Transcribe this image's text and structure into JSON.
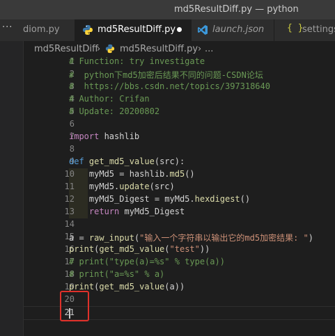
{
  "window": {
    "title": "md5ResultDiff.py — python"
  },
  "activity": {
    "overflow_glyph": "···"
  },
  "tabs": [
    {
      "label": "diom.py",
      "icon": "python-file-icon",
      "active": false
    },
    {
      "label": "md5ResultDiff.py",
      "icon": "python-file-icon",
      "active": true,
      "modified": true
    },
    {
      "label": "launch.json",
      "icon": "vscode-config-icon",
      "active": false
    },
    {
      "label": "settings",
      "icon": "json-braces-icon",
      "active": false
    }
  ],
  "breadcrumb": {
    "folder": "md5ResultDiff",
    "sep1": "›",
    "file": "md5ResultDiff.py",
    "sep2": "›",
    "trail": "..."
  },
  "icons": {
    "json_braces": "{ }"
  },
  "editor": {
    "lines": [
      {
        "n": "1",
        "parts": [
          {
            "t": "# Function: try investigate",
            "c": "c-com"
          }
        ]
      },
      {
        "n": "2",
        "parts": [
          {
            "t": "#  python下md5加密后结果不同的问题-CSDN论坛",
            "c": "c-com"
          }
        ]
      },
      {
        "n": "3",
        "parts": [
          {
            "t": "#  https://bbs.csdn.net/topics/397318640",
            "c": "c-com"
          }
        ]
      },
      {
        "n": "4",
        "parts": [
          {
            "t": "# Author: Crifan",
            "c": "c-com"
          }
        ]
      },
      {
        "n": "5",
        "parts": [
          {
            "t": "# Update: 20200802",
            "c": "c-com"
          }
        ]
      },
      {
        "n": "6",
        "parts": []
      },
      {
        "n": "7",
        "parts": [
          {
            "t": "import",
            "c": "c-kw2"
          },
          {
            "t": " hashlib",
            "c": "c-txt"
          }
        ]
      },
      {
        "n": "8",
        "parts": []
      },
      {
        "n": "9",
        "parts": [
          {
            "t": "def",
            "c": "c-kw"
          },
          {
            "t": " ",
            "c": "c-txt"
          },
          {
            "t": "get_md5_value",
            "c": "c-fn"
          },
          {
            "t": "(src):",
            "c": "c-txt"
          }
        ]
      },
      {
        "n": "10",
        "indent": true,
        "parts": [
          {
            "t": "    myMd5 = hashlib.",
            "c": "c-txt"
          },
          {
            "t": "md5",
            "c": "c-fn"
          },
          {
            "t": "()",
            "c": "c-txt"
          }
        ]
      },
      {
        "n": "11",
        "indent": true,
        "parts": [
          {
            "t": "    myMd5.",
            "c": "c-txt"
          },
          {
            "t": "update",
            "c": "c-fn"
          },
          {
            "t": "(src)",
            "c": "c-txt"
          }
        ]
      },
      {
        "n": "12",
        "indent": true,
        "parts": [
          {
            "t": "    myMd5_Digest = myMd5.",
            "c": "c-txt"
          },
          {
            "t": "hexdigest",
            "c": "c-fn"
          },
          {
            "t": "()",
            "c": "c-txt"
          }
        ]
      },
      {
        "n": "13",
        "indent": true,
        "parts": [
          {
            "t": "    ",
            "c": "c-txt"
          },
          {
            "t": "return",
            "c": "c-kw2"
          },
          {
            "t": " myMd5_Digest",
            "c": "c-txt"
          }
        ]
      },
      {
        "n": "14",
        "parts": []
      },
      {
        "n": "15",
        "parts": [
          {
            "t": "a = ",
            "c": "c-txt"
          },
          {
            "t": "raw_input",
            "c": "c-fn"
          },
          {
            "t": "(",
            "c": "c-txt"
          },
          {
            "t": "\"输入一个字符串以输出它的md5加密结果: \"",
            "c": "c-str"
          },
          {
            "t": ")",
            "c": "c-txt"
          }
        ]
      },
      {
        "n": "16",
        "parts": [
          {
            "t": "print",
            "c": "c-fn"
          },
          {
            "t": "(",
            "c": "c-txt"
          },
          {
            "t": "get_md5_value",
            "c": "c-fn"
          },
          {
            "t": "(",
            "c": "c-txt"
          },
          {
            "t": "\"test\"",
            "c": "c-str"
          },
          {
            "t": "))",
            "c": "c-txt"
          }
        ]
      },
      {
        "n": "17",
        "parts": [
          {
            "t": "# print(\"type(a)=%s\" % type(a))",
            "c": "c-com"
          }
        ]
      },
      {
        "n": "18",
        "parts": [
          {
            "t": "# print(\"a=%s\" % a)",
            "c": "c-com"
          }
        ]
      },
      {
        "n": "19",
        "parts": [
          {
            "t": "print",
            "c": "c-fn"
          },
          {
            "t": "(",
            "c": "c-txt"
          },
          {
            "t": "get_md5_value",
            "c": "c-fn"
          },
          {
            "t": "(a))",
            "c": "c-txt"
          }
        ]
      },
      {
        "n": "20",
        "parts": []
      },
      {
        "n": "21",
        "parts": [],
        "current": true
      }
    ]
  },
  "colors": {
    "background": "#1e1e1e",
    "highlight_box": "#e0312a",
    "modified_dot": "#ffffff"
  }
}
